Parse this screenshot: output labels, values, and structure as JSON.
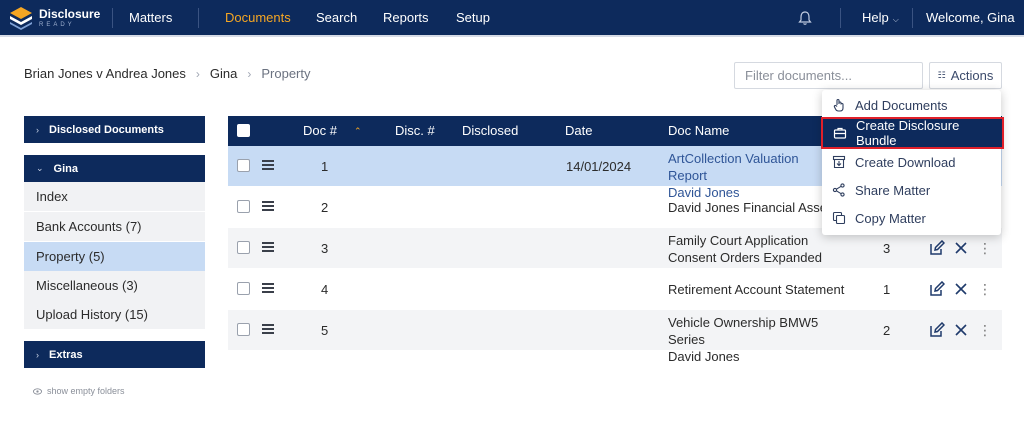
{
  "brand": {
    "name": "Disclosure",
    "tagline": "READY"
  },
  "nav": {
    "items": [
      "Matters",
      "Documents",
      "Search",
      "Reports",
      "Setup"
    ],
    "active": "Documents",
    "help": "Help",
    "welcome": "Welcome, Gina",
    "accent_color": "#f5a623",
    "bar_color": "#0d2a5c"
  },
  "breadcrumb": [
    "Brian Jones v Andrea Jones",
    "Gina",
    "Property"
  ],
  "toolbar": {
    "filter_placeholder": "Filter documents...",
    "actions_label": "Actions"
  },
  "actions_menu": [
    {
      "label": "Add Documents",
      "icon": "hand-pointer-icon"
    },
    {
      "label": "Create Disclosure Bundle",
      "icon": "briefcase-icon",
      "highlighted": true
    },
    {
      "label": "Create Download",
      "icon": "archive-download-icon"
    },
    {
      "label": "Share Matter",
      "icon": "share-icon"
    },
    {
      "label": "Copy Matter",
      "icon": "copy-icon"
    }
  ],
  "sidebar": {
    "disclosed_header": "Disclosed Documents",
    "folder_header": "Gina",
    "items": [
      "Index",
      "Bank Accounts (7)",
      "Property (5)",
      "Miscellaneous (3)",
      "Upload History (15)"
    ],
    "selected": "Property (5)",
    "extras_header": "Extras",
    "show_empty": "show empty folders"
  },
  "table": {
    "columns": [
      "Doc #",
      "Disc. #",
      "Disclosed",
      "Date",
      "Doc Name"
    ],
    "rows": [
      {
        "doc": "1",
        "date": "14/01/2024",
        "name": [
          "ArtCollection Valuation Report",
          "David Jones"
        ],
        "pages": "",
        "selected": true
      },
      {
        "doc": "2",
        "date": "",
        "name": [
          "David Jones Financial Assets"
        ],
        "pages": ""
      },
      {
        "doc": "3",
        "date": "",
        "name": [
          "Family Court Application",
          "Consent Orders Expanded"
        ],
        "pages": "3"
      },
      {
        "doc": "4",
        "date": "",
        "name": [
          "Retirement Account Statement"
        ],
        "pages": "1"
      },
      {
        "doc": "5",
        "date": "",
        "name": [
          "Vehicle Ownership BMW5 Series",
          "David Jones"
        ],
        "pages": "2"
      }
    ]
  }
}
